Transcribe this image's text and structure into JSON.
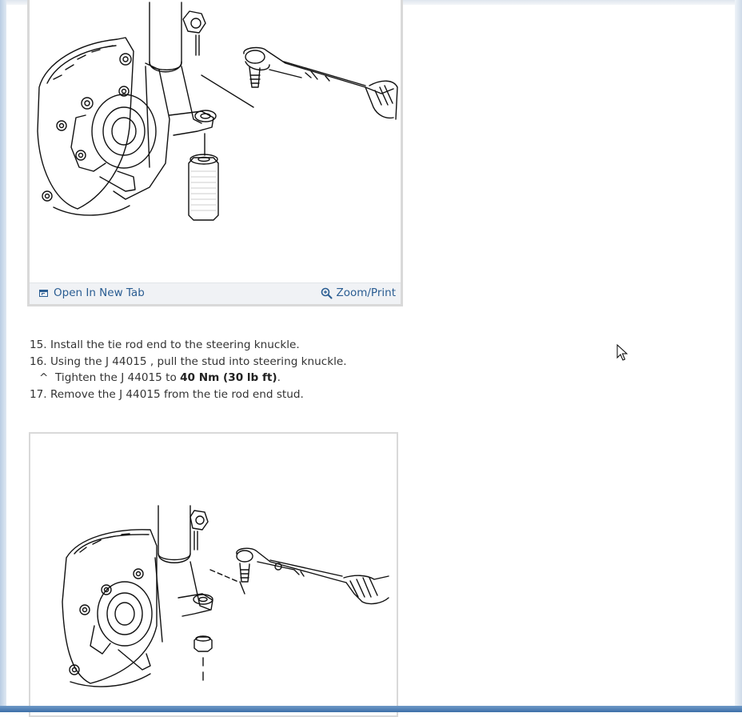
{
  "figure1": {
    "toolbar": {
      "open_new_tab": "Open In New Tab",
      "zoom_print": "Zoom/Print"
    },
    "icons": [
      "new-tab-icon",
      "zoom-icon"
    ]
  },
  "steps": [
    {
      "number": "15.",
      "text": "Install the tie rod end to the steering knuckle."
    },
    {
      "number": "16.",
      "text": "Using the J 44015 , pull the stud into steering knuckle."
    },
    {
      "number": "17.",
      "text": "Remove the J 44015 from the tie rod end stud."
    }
  ],
  "substep": {
    "bullet": "^",
    "text": "Tighten the J 44015 to",
    "torque": "40 Nm (30 lb ft)",
    "end": "."
  },
  "colors": {
    "link": "#2a5d92",
    "toolbar_bg": "#f0f2f5",
    "frame_border": "#d9d9d9",
    "taskbar": "#3d6fa8"
  }
}
